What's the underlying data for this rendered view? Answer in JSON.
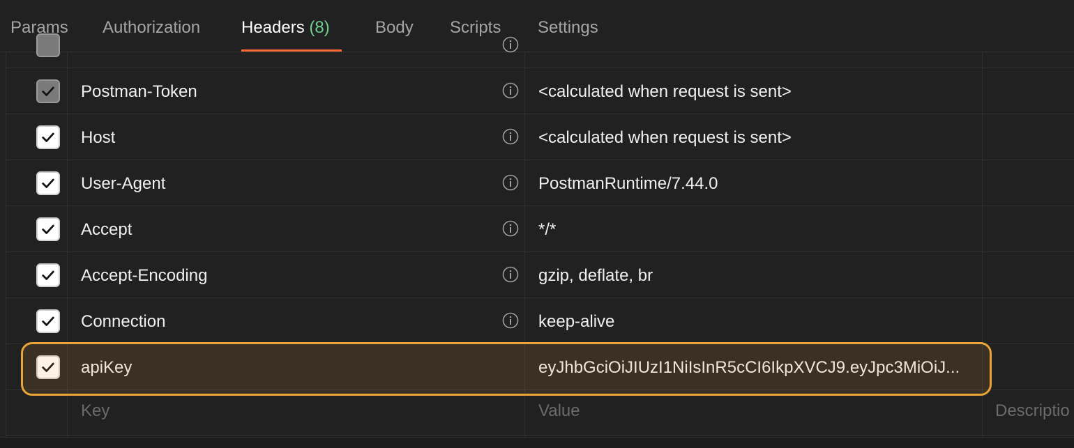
{
  "tabs": [
    {
      "label": "Params"
    },
    {
      "label": "Authorization"
    },
    {
      "label": "Headers",
      "count": "(8)",
      "active": true
    },
    {
      "label": "Body"
    },
    {
      "label": "Scripts"
    },
    {
      "label": "Settings"
    }
  ],
  "headers": [
    {
      "key": "Postman-Token",
      "value": "<calculated when request is sent>",
      "checked": true,
      "disabled": true
    },
    {
      "key": "Host",
      "value": "<calculated when request is sent>",
      "checked": true
    },
    {
      "key": "User-Agent",
      "value": "PostmanRuntime/7.44.0",
      "checked": true
    },
    {
      "key": "Accept",
      "value": "*/*",
      "checked": true
    },
    {
      "key": "Accept-Encoding",
      "value": "gzip, deflate, br",
      "checked": true
    },
    {
      "key": "Connection",
      "value": "keep-alive",
      "checked": true
    },
    {
      "key": "apiKey",
      "value": "eyJhbGciOiJIUzI1NiIsInR5cCI6IkpXVCJ9.eyJpc3MiOiJ...",
      "checked": true,
      "highlighted": true
    }
  ],
  "new_row": {
    "key_placeholder": "Key",
    "value_placeholder": "Value",
    "description_placeholder": "Descriptio"
  },
  "colors": {
    "accent_underline": "#ff6c37",
    "highlight_border": "#e9a43a",
    "count_green": "#6fcf8f"
  },
  "icons": {
    "info": "info-circle-icon",
    "check": "check-icon"
  }
}
